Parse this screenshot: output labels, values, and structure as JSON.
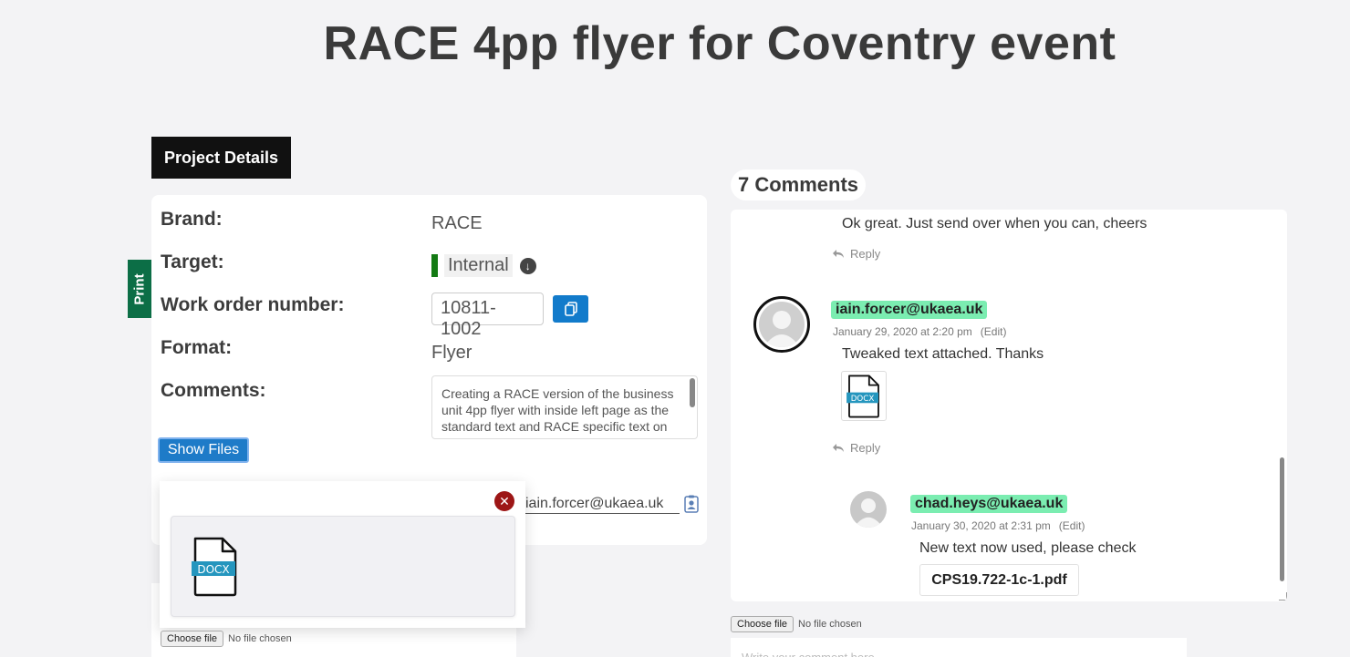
{
  "page": {
    "title": "RACE 4pp flyer for Coventry event"
  },
  "tabs": {
    "project_details": "Project Details",
    "print": "Print"
  },
  "details": {
    "brand_label": "Brand:",
    "brand_value": "RACE",
    "target_label": "Target:",
    "target_value": "Internal",
    "target_color": "#137a13",
    "work_order_label": "Work order number:",
    "work_order_value": "10811-1002",
    "format_label": "Format:",
    "format_value": "Flyer",
    "comments_label": "Comments:",
    "comments_value": "Creating a RACE version of the business unit 4pp flyer with inside left page as the standard text and RACE specific text on the inside right page.",
    "show_files_label": "Show Files",
    "owner_email": "iain.forcer@ukaea.uk"
  },
  "files_popup": {
    "file_type": "DOCX"
  },
  "file_upload_left": {
    "button": "Choose file",
    "status": "No file chosen"
  },
  "comments": {
    "count_label": "7 Comments",
    "items": [
      {
        "text": "Ok great. Just send over when you can, cheers",
        "reply": "Reply"
      },
      {
        "author": "iain.forcer@ukaea.uk",
        "date": "January 29, 2020 at 2:20 pm",
        "edit": "(Edit)",
        "text": "Tweaked text attached. Thanks",
        "attachment": "DOCX",
        "reply": "Reply"
      },
      {
        "author": "chad.heys@ukaea.uk",
        "date": "January 30, 2020 at 2:31 pm",
        "edit": "(Edit)",
        "text": "New text now used, please check",
        "attachment": "CPS19.722-1c-1.pdf"
      }
    ],
    "badge_color": "#7bedb1"
  },
  "file_upload_right": {
    "button": "Choose file",
    "status": "No file chosen"
  },
  "new_comment": {
    "placeholder": "Write your comment here..."
  }
}
